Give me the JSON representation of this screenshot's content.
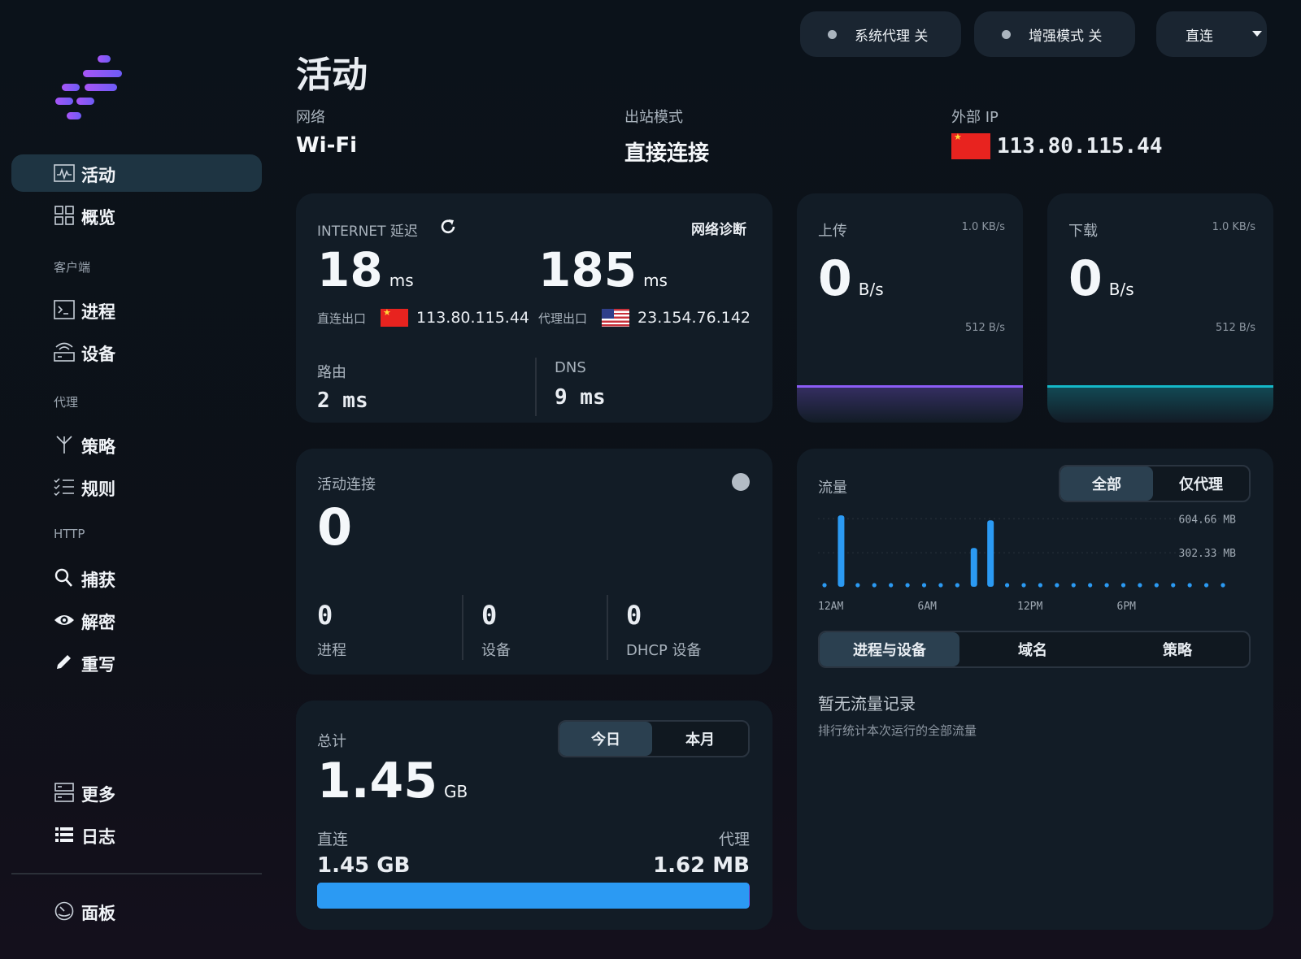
{
  "sidebar": {
    "items": [
      {
        "label": "活动",
        "icon": "activity-icon"
      },
      {
        "label": "概览",
        "icon": "grid-icon"
      },
      {
        "label": "进程",
        "icon": "terminal-icon"
      },
      {
        "label": "设备",
        "icon": "router-icon"
      },
      {
        "label": "策略",
        "icon": "fork-icon"
      },
      {
        "label": "规则",
        "icon": "checklist-icon"
      },
      {
        "label": "捕获",
        "icon": "search-icon"
      },
      {
        "label": "解密",
        "icon": "eye-icon"
      },
      {
        "label": "重写",
        "icon": "pencil-icon"
      },
      {
        "label": "更多",
        "icon": "server-icon"
      },
      {
        "label": "日志",
        "icon": "list-icon"
      },
      {
        "label": "面板",
        "icon": "gauge-icon"
      }
    ],
    "sections": [
      "客户端",
      "代理",
      "HTTP"
    ]
  },
  "topbar": {
    "system_proxy": "系统代理 关",
    "enhanced_mode": "增强模式 关",
    "mode": "直连"
  },
  "header": {
    "title": "活动",
    "network_label": "网络",
    "network_value": "Wi-Fi",
    "outbound_label": "出站模式",
    "outbound_value": "直接连接",
    "external_ip_label": "外部 IP",
    "external_ip_value": "113.80.115.44"
  },
  "latency": {
    "label": "INTERNET 延迟",
    "diag": "网络诊断",
    "direct_value": "18",
    "proxy_value": "185",
    "unit": "ms",
    "direct_exit_label": "直连出口",
    "direct_exit_ip": "113.80.115.44",
    "proxy_exit_label": "代理出口",
    "proxy_exit_ip": "23.154.76.142",
    "route_label": "路由",
    "route_value": "2 ms",
    "dns_label": "DNS",
    "dns_value": "9 ms"
  },
  "upload": {
    "label": "上传",
    "max": "1.0 KB/s",
    "mid": "512 B/s",
    "value": "0",
    "unit": "B/s",
    "color": "#8b5cf6"
  },
  "download": {
    "label": "下载",
    "max": "1.0 KB/s",
    "mid": "512 B/s",
    "value": "0",
    "unit": "B/s",
    "color": "#14b8c8"
  },
  "connections": {
    "label": "活动连接",
    "value": "0",
    "process_value": "0",
    "process_label": "进程",
    "device_value": "0",
    "device_label": "设备",
    "dhcp_value": "0",
    "dhcp_label": "DHCP 设备"
  },
  "total": {
    "label": "总计",
    "tab_today": "今日",
    "tab_month": "本月",
    "value": "1.45",
    "unit": "GB",
    "direct_label": "直连",
    "proxy_label": "代理",
    "direct_value": "1.45 GB",
    "proxy_value": "1.62 MB",
    "direct_fraction": 0.9989,
    "bar_color": "#2b9af3"
  },
  "traffic": {
    "label": "流量",
    "tab_all": "全部",
    "tab_proxy": "仅代理",
    "sub_tabs": [
      "进程与设备",
      "域名",
      "策略"
    ],
    "empty_title": "暂无流量记录",
    "empty_sub": "排行统计本次运行的全部流量"
  },
  "chart_data": {
    "type": "bar",
    "x": [
      "12AM",
      "1AM",
      "2AM",
      "3AM",
      "4AM",
      "5AM",
      "6AM",
      "7AM",
      "8AM",
      "9AM",
      "10AM",
      "11AM",
      "12PM",
      "1PM",
      "2PM",
      "3PM",
      "4PM",
      "5PM",
      "6PM",
      "7PM",
      "8PM",
      "9PM",
      "22PM",
      "23PM",
      "24"
    ],
    "values": [
      0,
      635,
      0,
      0,
      0,
      0,
      0,
      0,
      0,
      345,
      590,
      0,
      0,
      0,
      0,
      0,
      0,
      0,
      0,
      0,
      0,
      0,
      0,
      0,
      0
    ],
    "ylabel": "MB",
    "ytick_labels": [
      "604.66 MB",
      "302.33 MB"
    ],
    "yticks": [
      604.66,
      302.33
    ],
    "xtick_labels": [
      "12AM",
      "6AM",
      "12PM",
      "6PM"
    ],
    "ylim": [
      0,
      650
    ],
    "color": "#2b9af3"
  }
}
